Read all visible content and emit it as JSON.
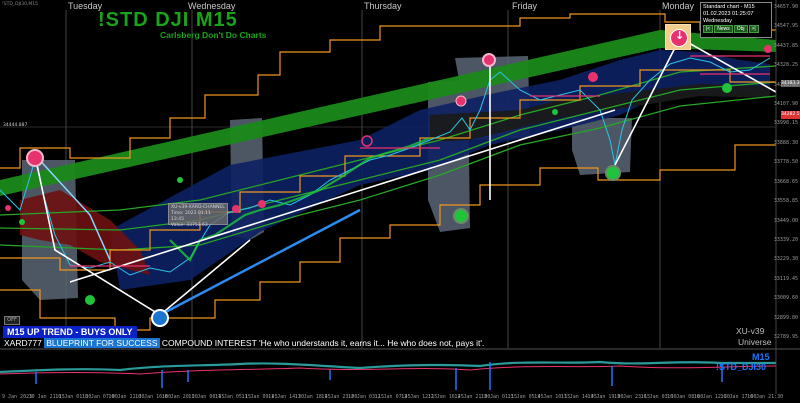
{
  "window": {
    "corner_label": "!STD_DJI30,M15",
    "price_marker": "34444.887"
  },
  "header": {
    "title": "!STD  DJI  M15",
    "subtitle": "Carlsberg Don't Do Charts"
  },
  "days": [
    "Tuesday",
    "Wednesday",
    "Thursday",
    "Friday",
    "Monday"
  ],
  "price_axis": [
    "34657.90",
    "34547.95",
    "34437.85",
    "34328.25",
    "34218.00",
    "34107.90",
    "33998.15",
    "33888.30",
    "33778.50",
    "33668.65",
    "33558.85",
    "33449.00",
    "33339.20",
    "33229.30",
    "33119.45",
    "33009.60",
    "32899.80",
    "32789.95"
  ],
  "time_axis": [
    "9 Jan 2023",
    "10 Jan 21:15",
    "10 Jan 01:30",
    "10 Jan 07:00",
    "10 Jan 11:30",
    "10 Jan 16:00",
    "10 Jan 20:30",
    "11 Jan 00:45",
    "11 Jan 05:15",
    "11 Jan 09:45",
    "11 Jan 14:30",
    "11 Jan 18:45",
    "11 Jan 23:00",
    "12 Jan 03:15",
    "12 Jan 07:45",
    "12 Jan 12:15",
    "12 Jan 16:45",
    "12 Jan 21:00",
    "13 Jan 01:15",
    "13 Jan 05:45",
    "13 Jan 10:15",
    "13 Jan 14:45",
    "13 Jan 19:00",
    "13 Jan 23:15",
    "16 Jan 03:30",
    "16 Jan 08:00",
    "16 Jan 12:30",
    "16 Jan 17:00",
    "16 Jan 21:30"
  ],
  "info_panel": {
    "line1": "Standard chart - M15",
    "line2": "01.02.2023       01:25:07",
    "line3": "Wednesday",
    "btn_back": "|<",
    "btn_news": "News",
    "btn_obj": "Obj",
    "btn_fwd": ">|"
  },
  "tooltip": {
    "line1": "XU-v39-XARD-CHANNEL",
    "line2": "Time: 2023.01.11 13:45",
    "line3": "Value: 33753.63"
  },
  "banner": {
    "trend": "M15 UP TREND - BUYS ONLY",
    "brand": "XARD777",
    "blueprint": "BLUEPRINT FOR SUCCESS",
    "compound": "COMPOUND INTEREST  'He who understands it, earns it... He who does not, pays it'."
  },
  "controls": {
    "off_label": "OFF"
  },
  "footer": {
    "version": "XU-v39",
    "universe": "Universe"
  },
  "subwindow": {
    "timeframe": "M15",
    "symbol": "!STD_DJI30"
  },
  "right_price_current": "34282.55",
  "right_price_mark": "34383.30",
  "icons": {
    "sell_signal": "sell-arrow-icon"
  },
  "colors": {
    "background": "#000000",
    "title_green": "#18a418",
    "band_orange": "#f0961e",
    "channel_navy": "#0a1a5a",
    "gray_box": "#5a6676",
    "accent_blue": "#1878ff",
    "sell_magenta": "#e8326e",
    "buy_green": "#1fc43a"
  }
}
